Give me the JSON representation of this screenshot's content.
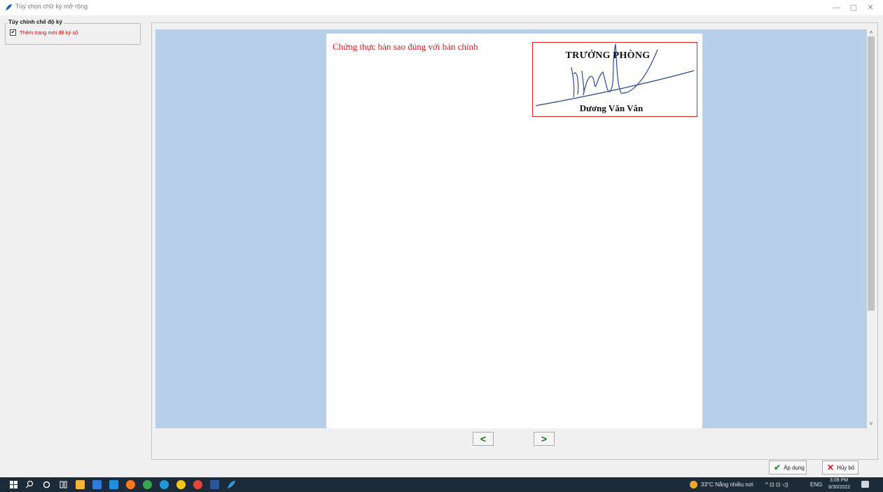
{
  "window": {
    "title": "Tùy chọn chữ ký mở rộng",
    "controls": {
      "minimize": "—",
      "maximize": "▢",
      "close": "✕"
    }
  },
  "options_group": {
    "legend": "Tùy chỉnh chế độ ký",
    "checkbox_label": "Thêm trang mới để ký số",
    "checkbox_checked": true,
    "checkbox_mark": "✔"
  },
  "document": {
    "certification_text": "Chứng thực bản sao đúng với bản chính",
    "signature": {
      "title": "TRƯỞNG PHÒNG",
      "name": "Dương Văn Vân"
    }
  },
  "navigation": {
    "prev": "<",
    "next": ">"
  },
  "actions": {
    "apply_label": "Áp dụng",
    "apply_icon": "✔",
    "cancel_label": "Hủy bỏ",
    "cancel_icon": "✕"
  },
  "scrollbar": {
    "up": "˄",
    "down": "˅"
  },
  "taskbar": {
    "weather": "33°C  Nắng nhiều nơi",
    "language": "ENG",
    "time": "3:09 PM",
    "date": "8/30/2022",
    "tray_symbols": "^  ⊡  ⊡  ◁)"
  },
  "colors": {
    "accent_red": "#e8141b",
    "viewport_blue": "#b8cfe9",
    "nav_green": "#1a6e1a",
    "taskbar": "#1d2b39"
  }
}
